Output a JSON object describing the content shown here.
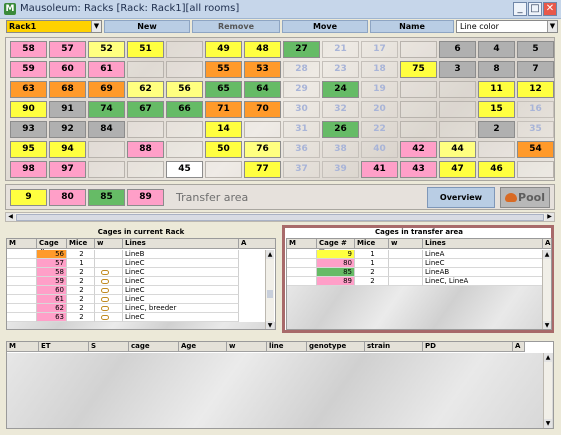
{
  "window": {
    "title": "Mausoleum: Racks [Rack: Rack1][all rooms]",
    "app_icon": "M",
    "min": "_",
    "max": "□",
    "close": "✕"
  },
  "toolbar": {
    "rack": "Rack1",
    "new": "New",
    "remove": "Remove",
    "move": "Move",
    "name": "Name",
    "color_mode": "Line color"
  },
  "rack_cells": [
    [
      {
        "n": "58",
        "c": "#ff9fc8"
      },
      {
        "n": "57",
        "c": "#ff9fc8"
      },
      {
        "n": "52",
        "c": "#ffff80"
      },
      {
        "n": "51",
        "c": "#ffff40"
      },
      {
        "n": ""
      },
      {
        "n": "49",
        "c": "#ffff40"
      },
      {
        "n": "48",
        "c": "#ffff40"
      },
      {
        "n": "27",
        "c": "#66bb66"
      },
      {
        "n": "21",
        "t": 1
      },
      {
        "n": "17",
        "t": 1
      },
      {
        "n": ""
      },
      {
        "n": "6",
        "c": "#b0b0b0"
      },
      {
        "n": "4",
        "c": "#b0b0b0"
      },
      {
        "n": "5",
        "c": "#b0b0b0"
      }
    ],
    [
      {
        "n": "59",
        "c": "#ff9fc8"
      },
      {
        "n": "60",
        "c": "#ff9fc8"
      },
      {
        "n": "61",
        "c": "#ff9fc8"
      },
      {
        "n": ""
      },
      {
        "n": ""
      },
      {
        "n": "55",
        "c": "#ff9a2a"
      },
      {
        "n": "53",
        "c": "#ff9a2a"
      },
      {
        "n": "28",
        "t": 1
      },
      {
        "n": "23",
        "t": 1
      },
      {
        "n": "18",
        "t": 1
      },
      {
        "n": "75",
        "c": "#ffff40"
      },
      {
        "n": "3",
        "c": "#b0b0b0"
      },
      {
        "n": "8",
        "c": "#b0b0b0"
      },
      {
        "n": "7",
        "c": "#b0b0b0"
      }
    ],
    [
      {
        "n": "63",
        "c": "#ff9a2a"
      },
      {
        "n": "68",
        "c": "#ff9a2a"
      },
      {
        "n": "69",
        "c": "#ff9a2a"
      },
      {
        "n": "62",
        "c": "#ffff80"
      },
      {
        "n": "56",
        "c": "#ffff80"
      },
      {
        "n": "65",
        "c": "#66bb66"
      },
      {
        "n": "64",
        "c": "#66bb66"
      },
      {
        "n": "29",
        "t": 1
      },
      {
        "n": "24",
        "c": "#66bb66"
      },
      {
        "n": "19",
        "t": 1
      },
      {
        "n": ""
      },
      {
        "n": ""
      },
      {
        "n": "11",
        "c": "#ffff40"
      },
      {
        "n": "12",
        "c": "#ffff40"
      }
    ],
    [
      {
        "n": "90",
        "c": "#ffff40"
      },
      {
        "n": "91",
        "c": "#b0b0b0"
      },
      {
        "n": "74",
        "c": "#66bb66"
      },
      {
        "n": "67",
        "c": "#66bb66"
      },
      {
        "n": "66",
        "c": "#66bb66"
      },
      {
        "n": "71",
        "c": "#ff9a2a"
      },
      {
        "n": "70",
        "c": "#ff9a2a"
      },
      {
        "n": "30",
        "t": 1
      },
      {
        "n": "32",
        "t": 1
      },
      {
        "n": "20",
        "t": 1
      },
      {
        "n": ""
      },
      {
        "n": ""
      },
      {
        "n": "15",
        "c": "#ffff40"
      },
      {
        "n": "16",
        "t": 1
      }
    ],
    [
      {
        "n": "93",
        "c": "#b0b0b0"
      },
      {
        "n": "92",
        "c": "#b0b0b0"
      },
      {
        "n": "84",
        "c": "#b0b0b0"
      },
      {
        "n": ""
      },
      {
        "n": ""
      },
      {
        "n": "14",
        "c": "#ffff40"
      },
      {
        "n": ""
      },
      {
        "n": "31",
        "t": 1
      },
      {
        "n": "26",
        "c": "#66bb66"
      },
      {
        "n": "22",
        "t": 1
      },
      {
        "n": ""
      },
      {
        "n": ""
      },
      {
        "n": "2",
        "c": "#b0b0b0"
      },
      {
        "n": "35",
        "t": 1
      }
    ],
    [
      {
        "n": "95",
        "c": "#ffff40"
      },
      {
        "n": "94",
        "c": "#ffff40"
      },
      {
        "n": ""
      },
      {
        "n": "88",
        "c": "#ff9fc8"
      },
      {
        "n": ""
      },
      {
        "n": "50",
        "c": "#ffff40"
      },
      {
        "n": "76",
        "c": "#ffff80"
      },
      {
        "n": "36",
        "t": 1
      },
      {
        "n": "38",
        "t": 1
      },
      {
        "n": "40",
        "t": 1
      },
      {
        "n": "42",
        "c": "#ff9fc8"
      },
      {
        "n": "44",
        "c": "#ffff80"
      },
      {
        "n": ""
      },
      {
        "n": "54",
        "c": "#ff9a2a"
      }
    ],
    [
      {
        "n": "98",
        "c": "#ff9fc8"
      },
      {
        "n": "97",
        "c": "#ff9fc8"
      },
      {
        "n": ""
      },
      {
        "n": ""
      },
      {
        "n": "45",
        "c": "#ffffff"
      },
      {
        "n": ""
      },
      {
        "n": "77",
        "c": "#ffff40"
      },
      {
        "n": "37",
        "t": 1
      },
      {
        "n": "39",
        "t": 1
      },
      {
        "n": "41",
        "c": "#ff9fc8"
      },
      {
        "n": "43",
        "c": "#ff9fc8"
      },
      {
        "n": "47",
        "c": "#ffff40"
      },
      {
        "n": "46",
        "c": "#ffff40"
      },
      {
        "n": ""
      }
    ]
  ],
  "transfer": {
    "cells": [
      {
        "n": "9",
        "c": "#ffff40"
      },
      {
        "n": "80",
        "c": "#ff9fc8"
      },
      {
        "n": "85",
        "c": "#66bb66"
      },
      {
        "n": "89",
        "c": "#ff9fc8"
      }
    ],
    "label": "Transfer area",
    "overview": "Overview",
    "pool": "Pool"
  },
  "current_rack": {
    "title": "Cages in current Rack",
    "headers": [
      "M",
      "Cage #",
      "Mice",
      "w",
      "Lines",
      "A"
    ],
    "rows": [
      {
        "cage": "56",
        "mice": "2",
        "w": "",
        "line": "LineB",
        "c": "#ff9a2a"
      },
      {
        "cage": "57",
        "mice": "1",
        "w": "",
        "line": "LineC",
        "c": "#ff9fc8"
      },
      {
        "cage": "58",
        "mice": "2",
        "w": "fish",
        "line": "LineC",
        "c": "#ff9fc8"
      },
      {
        "cage": "59",
        "mice": "2",
        "w": "fish",
        "line": "LineC",
        "c": "#ff9fc8"
      },
      {
        "cage": "60",
        "mice": "2",
        "w": "fish",
        "line": "LineC",
        "c": "#ff9fc8"
      },
      {
        "cage": "61",
        "mice": "2",
        "w": "fish",
        "line": "LineC",
        "c": "#ff9fc8"
      },
      {
        "cage": "62",
        "mice": "2",
        "w": "fish",
        "line": "LineC, breeder",
        "c": "#ff9fc8"
      },
      {
        "cage": "63",
        "mice": "2",
        "w": "fish",
        "line": "LineC",
        "c": "#ff9fc8"
      }
    ]
  },
  "transfer_table": {
    "title": "Cages in transfer area",
    "headers": [
      "M",
      "Cage #",
      "Mice",
      "w",
      "Lines",
      "A"
    ],
    "sort_icon": "▽",
    "rows": [
      {
        "cage": "9",
        "mice": "1",
        "line": "LineA",
        "c": "#ffff40"
      },
      {
        "cage": "80",
        "mice": "1",
        "line": "LineC",
        "c": "#ff9fc8"
      },
      {
        "cage": "85",
        "mice": "2",
        "line": "LineAB",
        "c": "#66bb66"
      },
      {
        "cage": "89",
        "mice": "2",
        "line": "LineC, LineA",
        "c": "#ff9fc8"
      }
    ]
  },
  "mice_table": {
    "headers": [
      "M",
      "ET",
      "S",
      "cage",
      "Age",
      "w",
      "line",
      "genotype",
      "strain",
      "PD",
      "A"
    ]
  },
  "icons": {
    "up": "▲",
    "down": "▼",
    "left": "◀",
    "right": "▶",
    "dd": "▼"
  }
}
